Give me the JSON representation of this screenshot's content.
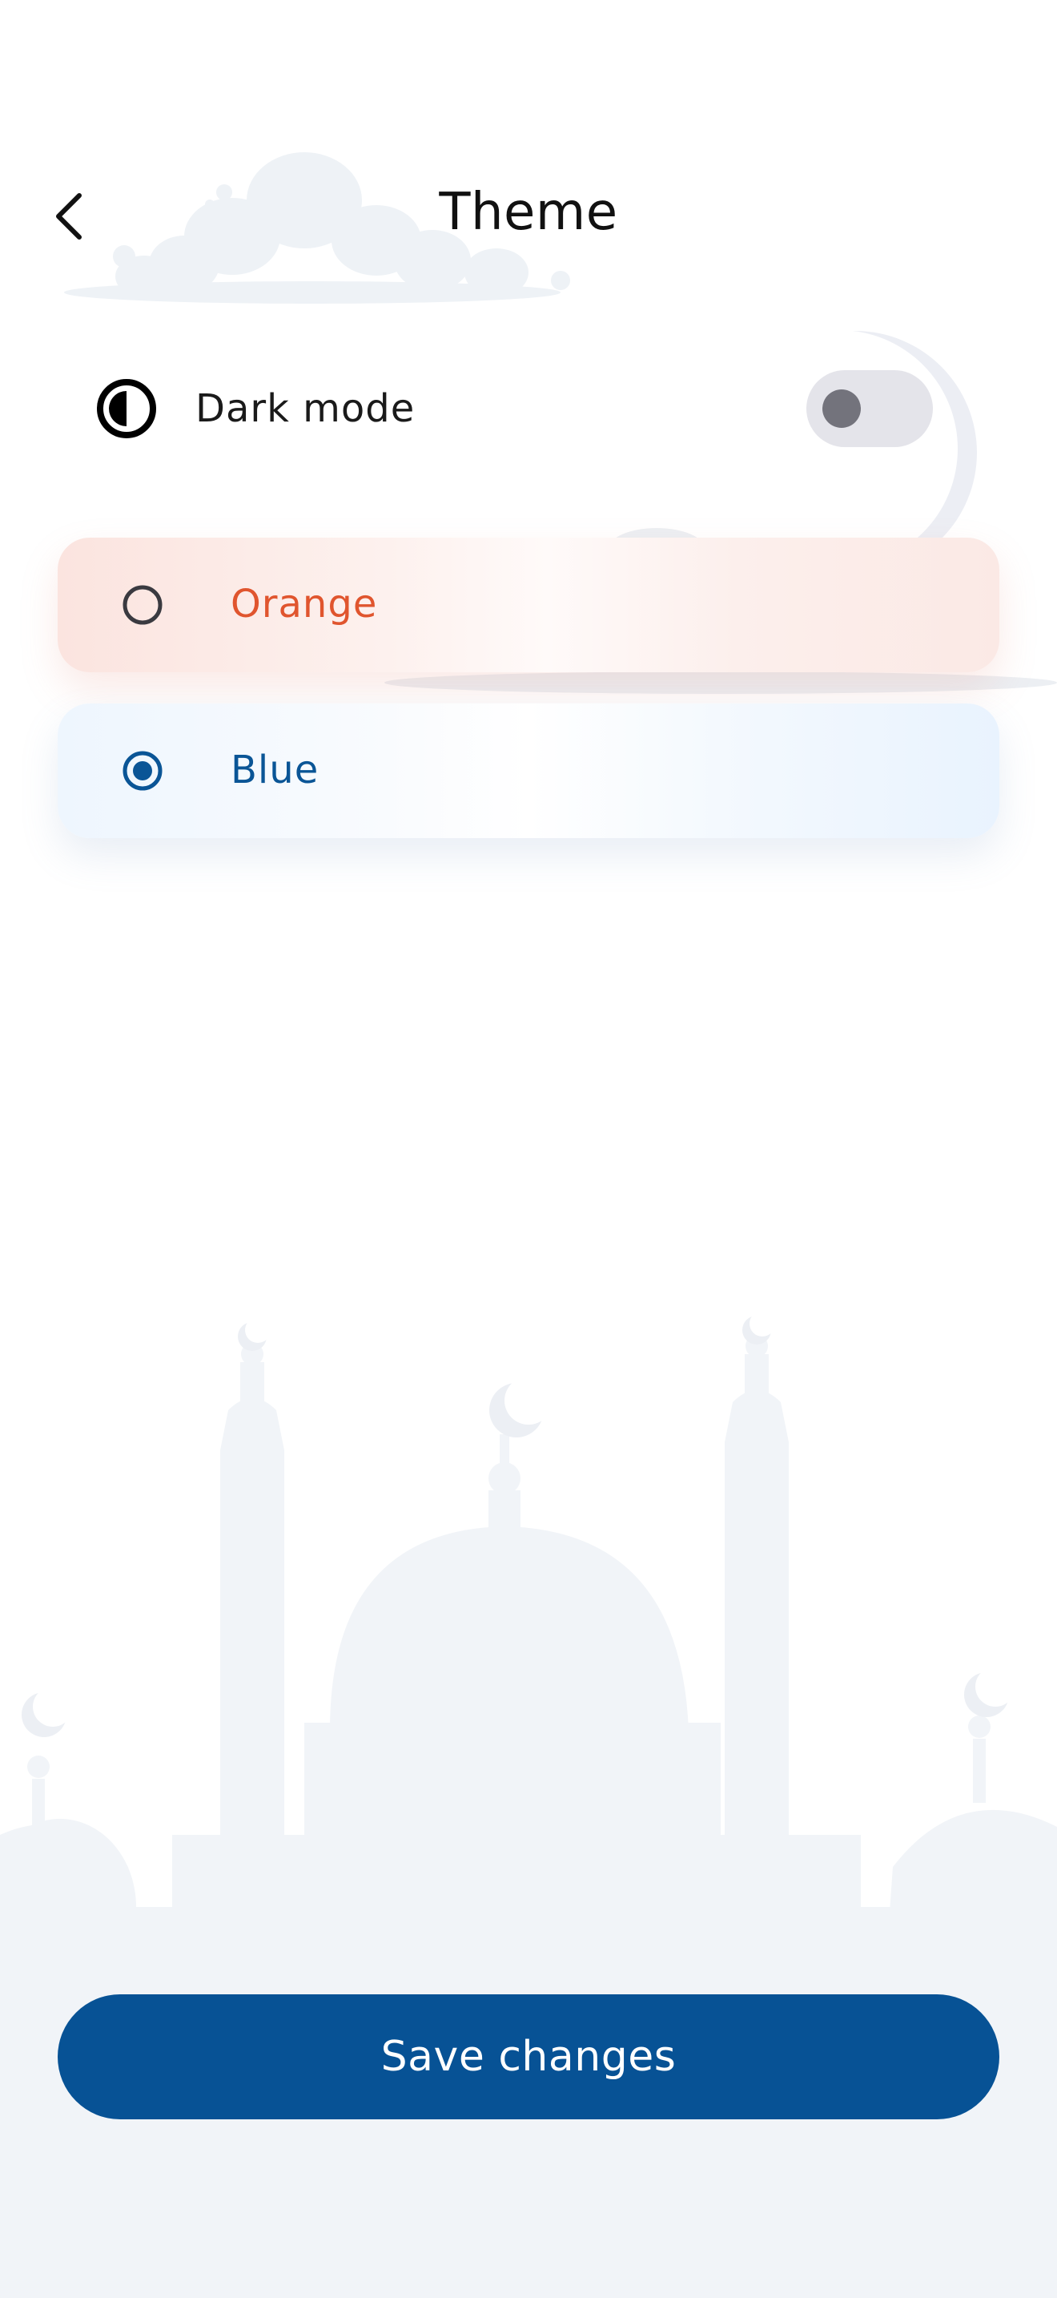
{
  "header": {
    "title": "Theme",
    "back_icon": "chevron-left-icon"
  },
  "dark_mode": {
    "label": "Dark mode",
    "icon": "contrast-icon",
    "enabled": false
  },
  "theme_options": [
    {
      "label": "Orange",
      "selected": false,
      "color": "#e0552e",
      "radio_color": "#3a3a40"
    },
    {
      "label": "Blue",
      "selected": true,
      "color": "#0a5596",
      "radio_color": "#0a5596"
    }
  ],
  "save_button": {
    "label": "Save changes"
  },
  "colors": {
    "primary": "#075295",
    "background_art": "#f1f4f8",
    "text": "#111111"
  }
}
